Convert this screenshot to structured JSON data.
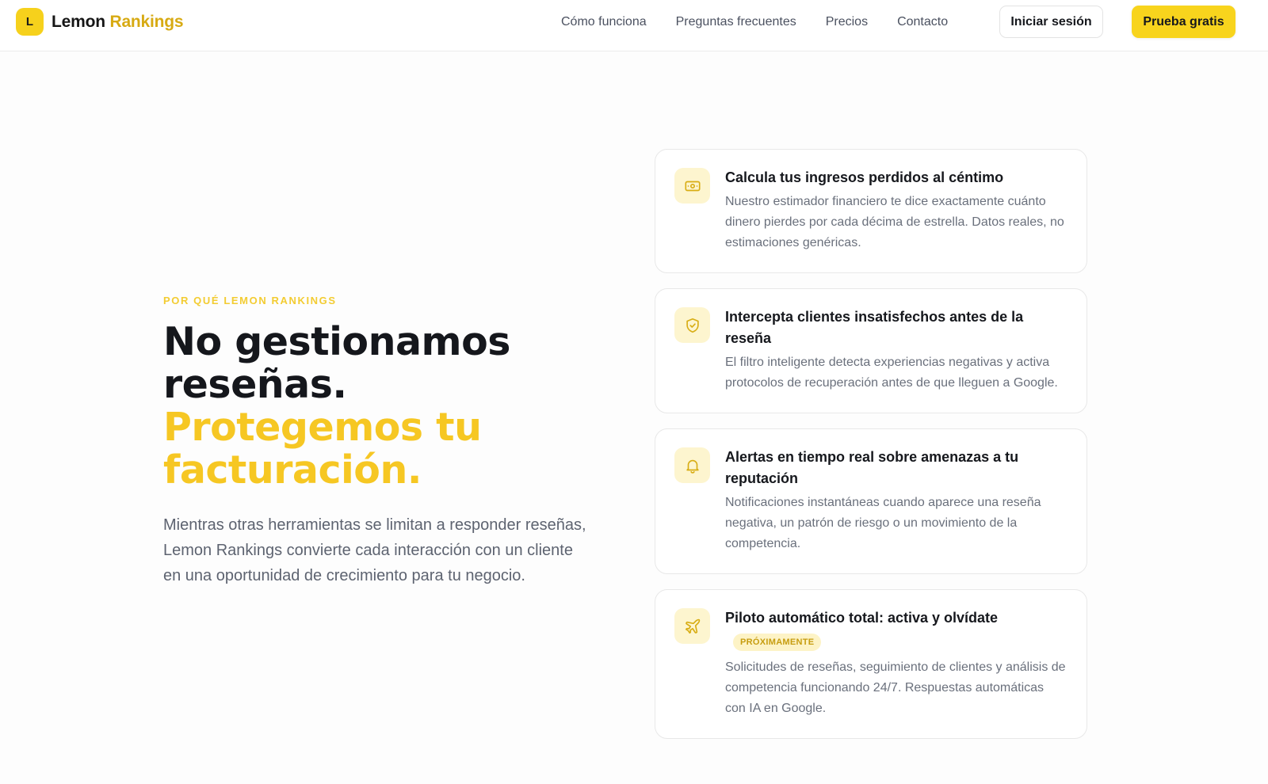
{
  "brand": {
    "mark": "L",
    "name_part1": "Lemon",
    "name_part2": "Rankings"
  },
  "nav": {
    "links": [
      "Cómo funciona",
      "Preguntas frecuentes",
      "Precios",
      "Contacto"
    ],
    "login_label": "Iniciar sesión",
    "trial_label": "Prueba gratis"
  },
  "hero": {
    "eyebrow": "POR QUÉ LEMON RANKINGS",
    "headline_line1": "No gestionamos",
    "headline_line2": "reseñas.",
    "headline_line3": "Protegemos tu",
    "headline_line4": "facturación.",
    "description": "Mientras otras herramientas se limitan a responder reseñas, Lemon Rankings convierte cada interacción con un cliente en una oportunidad de crecimiento para tu negocio."
  },
  "features": [
    {
      "icon": "money-icon",
      "title": "Calcula tus ingresos perdidos al céntimo",
      "description": "Nuestro estimador financiero te dice exactamente cuánto dinero pierdes por cada décima de estrella. Datos reales, no estimaciones genéricas."
    },
    {
      "icon": "shield-check-icon",
      "title": "Intercepta clientes insatisfechos antes de la reseña",
      "description": "El filtro inteligente detecta experiencias negativas y activa protocolos de recuperación antes de que lleguen a Google."
    },
    {
      "icon": "bell-icon",
      "title": "Alertas en tiempo real sobre amenazas a tu reputación",
      "description": "Notificaciones instantáneas cuando aparece una reseña negativa, un patrón de riesgo o un movimiento de la competencia."
    },
    {
      "icon": "plane-icon",
      "title": "Piloto automático total: activa y olvídate",
      "badge": "PRÓXIMAMENTE",
      "description": "Solicitudes de reseñas, seguimiento de clientes y análisis de competencia funcionando 24/7. Respuestas automáticas con IA en Google."
    }
  ],
  "colors": {
    "accent": "#f8d41d",
    "accent_text": "#f6c723",
    "icon_bg": "#fdf5cf"
  }
}
